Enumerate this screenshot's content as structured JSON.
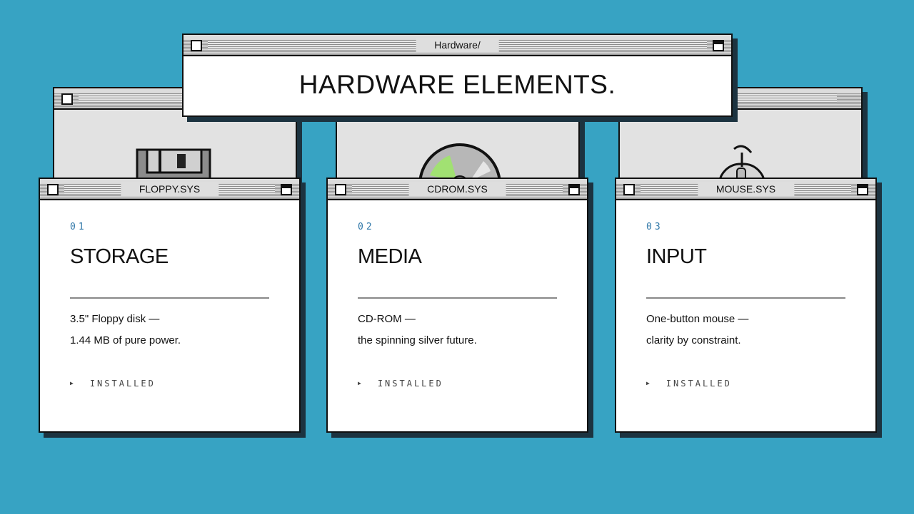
{
  "header_window": {
    "title": "Hardware/",
    "heading": "HARDWARE ELEMENTS."
  },
  "cards": [
    {
      "window_title": "FLOPPY.SYS",
      "number": "01",
      "title": "STORAGE",
      "desc_line1": "3.5\" Floppy disk —",
      "desc_line2": "1.44 MB of pure power.",
      "status": "INSTALLED",
      "icon": "floppy-disk-icon"
    },
    {
      "window_title": "CDROM.SYS",
      "number": "02",
      "title": "MEDIA",
      "desc_line1": "CD-ROM —",
      "desc_line2": "the spinning silver future.",
      "status": "INSTALLED",
      "icon": "cd-rom-icon"
    },
    {
      "window_title": "MOUSE.SYS",
      "number": "03",
      "title": "INPUT",
      "desc_line1": "One-button mouse —",
      "desc_line2": "clarity by constraint.",
      "status": "INSTALLED",
      "icon": "mouse-icon"
    }
  ],
  "colors": {
    "background": "#37a3c3",
    "number_accent": "#2f77a8",
    "cd_highlight": "#9ee66a"
  }
}
